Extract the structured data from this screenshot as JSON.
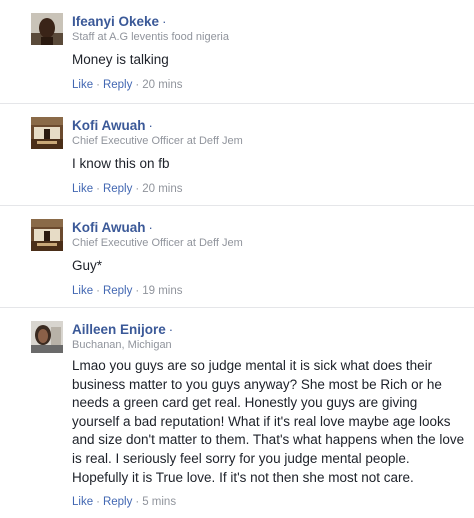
{
  "comments": [
    {
      "author": "Ifeanyi Okeke",
      "dot": "·",
      "title": "Staff at A.G leventis food nigeria",
      "text": "Money is talking",
      "like": "Like",
      "sep": "·",
      "reply": "Reply",
      "time": "20 mins",
      "avatar_icon": "profile-photo-man"
    },
    {
      "author": "Kofi Awuah",
      "dot": "·",
      "title": "Chief Executive Officer at Deff Jem",
      "text": "I know this on fb",
      "like": "Like",
      "sep": "·",
      "reply": "Reply",
      "time": "20 mins",
      "avatar_icon": "profile-photo-desk"
    },
    {
      "author": "Kofi Awuah",
      "dot": "·",
      "title": "Chief Executive Officer at Deff Jem",
      "text": "Guy*",
      "like": "Like",
      "sep": "·",
      "reply": "Reply",
      "time": "19 mins",
      "avatar_icon": "profile-photo-desk"
    },
    {
      "author": "Ailleen Enijore",
      "dot": "·",
      "title": "Buchanan, Michigan",
      "text": "Lmao you guys are so judge mental it is sick what does their business matter to you guys anyway? She most be Rich or he needs a green card get real. Honestly you guys are giving yourself a bad reputation! What if it's real love maybe age looks and size don't matter to them. That's what happens when the love is real. I seriously feel sorry for you judge mental people. Hopefully it is True love. If it's not then she most not care.",
      "like": "Like",
      "sep": "·",
      "reply": "Reply",
      "time": "5 mins",
      "avatar_icon": "profile-photo-woman"
    }
  ]
}
